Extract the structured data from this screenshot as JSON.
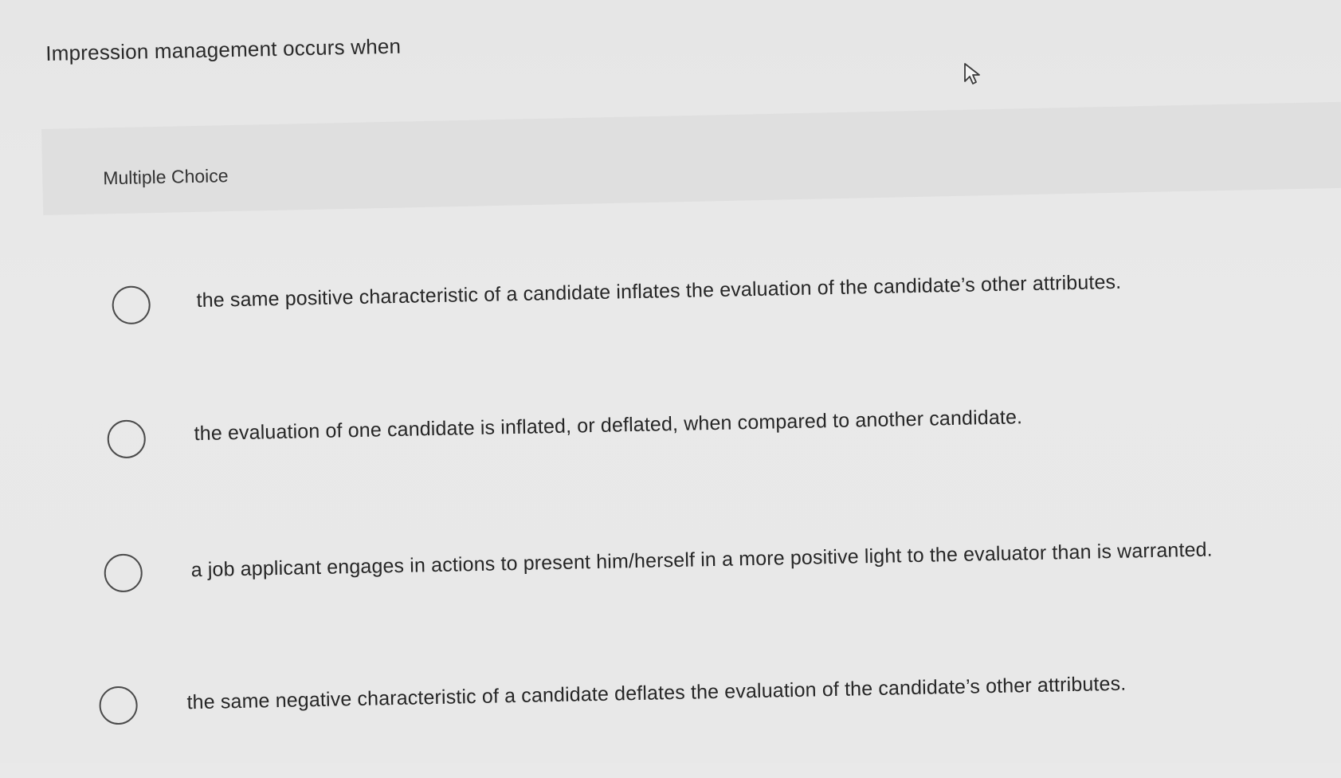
{
  "question": {
    "text": "Impression management occurs when"
  },
  "section": {
    "label": "Multiple Choice"
  },
  "options": [
    {
      "text": "the same positive characteristic of a candidate inflates the evaluation of the candidate’s other attributes."
    },
    {
      "text": "the evaluation of one candidate is inflated, or deflated, when compared to another candidate."
    },
    {
      "text": "a job applicant engages in actions to present him/herself in a more positive light to the evaluator than is warranted."
    },
    {
      "text": "the same negative characteristic of a candidate deflates the evaluation of the candidate’s other attributes."
    }
  ],
  "icons": {
    "cursor": "mouse-pointer-icon",
    "radio": "radio-unselected-icon"
  }
}
